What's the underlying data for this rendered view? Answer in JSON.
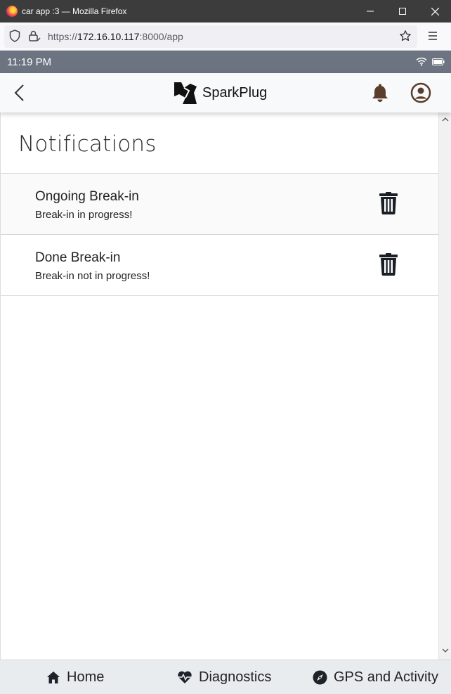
{
  "window": {
    "title": "car app :3 — Mozilla Firefox",
    "minimize_icon": "minimize-icon",
    "maximize_icon": "maximize-icon",
    "close_icon": "close-icon"
  },
  "browser": {
    "url_scheme": "https://",
    "url_host": "172.16.10.117",
    "url_rest": ":8000/app"
  },
  "status": {
    "time": "11:19 PM"
  },
  "header": {
    "brand": "SparkPlug"
  },
  "page": {
    "title": "Notifications"
  },
  "notifications": [
    {
      "title": "Ongoing Break-in",
      "body": "Break-in in progress!"
    },
    {
      "title": "Done Break-in",
      "body": "Break-in not in progress!"
    }
  ],
  "tabs": [
    {
      "label": "Home"
    },
    {
      "label": "Diagnostics"
    },
    {
      "label": "GPS and Activity"
    }
  ],
  "colors": {
    "statusbar": "#6b7480",
    "header_bg": "#f8f9fa",
    "bell": "#5a3e2b",
    "account": "#5a3e2b",
    "tabbar_bg": "#e9ecef"
  }
}
